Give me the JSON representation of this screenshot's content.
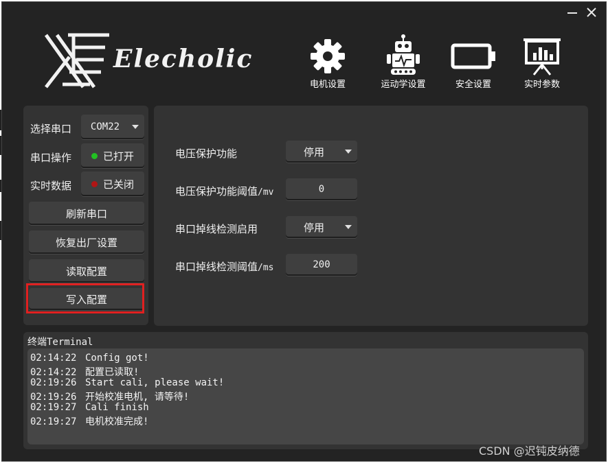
{
  "app": {
    "logo_text": "Elecholic"
  },
  "nav": [
    {
      "label": "电机设置",
      "icon": "gear-icon"
    },
    {
      "label": "运动学设置",
      "icon": "robot-icon"
    },
    {
      "label": "安全设置",
      "icon": "battery-icon"
    },
    {
      "label": "实时参数",
      "icon": "chart-board-icon"
    }
  ],
  "left": {
    "port_label": "选择串口",
    "port_value": "COM22",
    "port_op_label": "串口操作",
    "port_op_button": "已打开",
    "port_op_color": "#22c022",
    "realtime_label": "实时数据",
    "realtime_button": "已关闭",
    "realtime_color": "#b01515",
    "refresh_button": "刷新串口",
    "factory_button": "恢复出厂设置",
    "read_button": "读取配置",
    "write_button": "写入配置"
  },
  "settings": {
    "voltage_protect_label": "电压保护功能",
    "voltage_protect_value": "停用",
    "voltage_threshold_label": "电压保护功能阈值",
    "voltage_threshold_unit": "/mv",
    "voltage_threshold_value": "0",
    "disconnect_label": "串口掉线检测启用",
    "disconnect_value": "停用",
    "disconnect_threshold_label": "串口掉线检测阈值",
    "disconnect_threshold_unit": "/ms",
    "disconnect_threshold_value": "200"
  },
  "terminal": {
    "title_cn": "终端",
    "title_en": "Terminal",
    "lines": [
      {
        "time": "02:14:22",
        "msg": "Config got!"
      },
      {
        "time": "02:14:22",
        "msg": "配置已读取!"
      },
      {
        "time": "02:19:26",
        "msg": "Start cali, please wait!"
      },
      {
        "time": "02:19:26",
        "msg": "开始校准电机, 请等待!"
      },
      {
        "time": "02:19:27",
        "msg": "Cali finish"
      },
      {
        "time": "02:19:27",
        "msg": "电机校准完成!"
      }
    ]
  },
  "watermark": "CSDN @迟钝皮纳德",
  "colors": {
    "highlight": "#e02020"
  }
}
